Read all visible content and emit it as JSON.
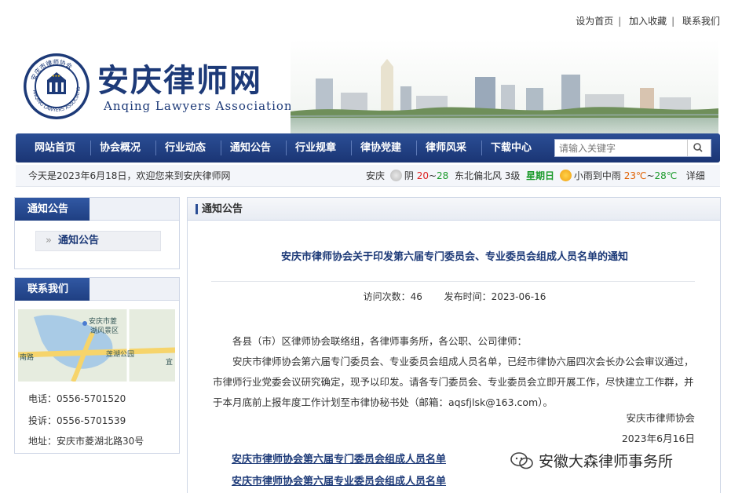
{
  "top_links": [
    "设为首页",
    "加入收藏",
    "联系我们"
  ],
  "site": {
    "name_cn": "安庆律师网",
    "name_en": "Anqing Lawyers Association",
    "seal_text": "安庆市律师协会 ANQING LAWYERS ASSOCIATION"
  },
  "nav": {
    "items": [
      "网站首页",
      "协会概况",
      "行业动态",
      "通知公告",
      "行业规章",
      "律协党建",
      "律师风采",
      "下载中心"
    ],
    "search_placeholder": "请输入关键字"
  },
  "infobar": {
    "today": "今天是2023年6月18日，欢迎您来到安庆律师网",
    "city": "安庆",
    "weather1": "阴",
    "temp_low1": "20",
    "temp_sep": "~",
    "temp_high1": "28",
    "wind": "东北偏北风 3级",
    "weekday": "星期日",
    "weather2": "小雨到中雨",
    "temp2_a": "23℃",
    "temp2_b": "28℃",
    "more": "详细"
  },
  "sidebar": {
    "notice_title": "通知公告",
    "notice_item": "通知公告",
    "contact_title": "联系我们",
    "map_labels": [
      "安庆市菱",
      "湖风景区",
      "莲湖公园",
      "南路",
      "宜"
    ],
    "phone": "电话：0556-5701520",
    "complaint": "投诉：0556-5701539",
    "address": "地址：安庆市菱湖北路30号"
  },
  "main": {
    "section_title": "通知公告",
    "article_title": "安庆市律师协会关于印发第六届专门委员会、专业委员会组成人员名单的通知",
    "visits_label": "访问次数：",
    "visits": "46",
    "date_label": "发布时间：",
    "date": "2023-06-16",
    "greeting": "各县（市）区律师协会联络组，各律师事务所，各公职、公司律师：",
    "body": "安庆市律师协会第六届专门委员会、专业委员会组成人员名单，已经市律协六届四次会长办公会审议通过，市律师行业党委会议研究确定，现予以印发。请各专门委员会、专业委员会立即开展工作，尽快建立工作群，并于本月底前上报年度工作计划至市律协秘书处（邮箱：aqsfjlsk@163.com）。",
    "signer": "安庆市律师协会",
    "sign_date": "2023年6月16日",
    "attachment1": "安庆市律师协会第六届专门委员会组成人员名单",
    "attachment2": "安庆市律师协会第六届专业委员会组成人员名单"
  },
  "watermark": "安徽大森律师事务所",
  "colors": {
    "brand": "#1d3a78",
    "nav": "#2b4e95",
    "accent_red": "#dd2222",
    "accent_green": "#1a9a2a"
  }
}
